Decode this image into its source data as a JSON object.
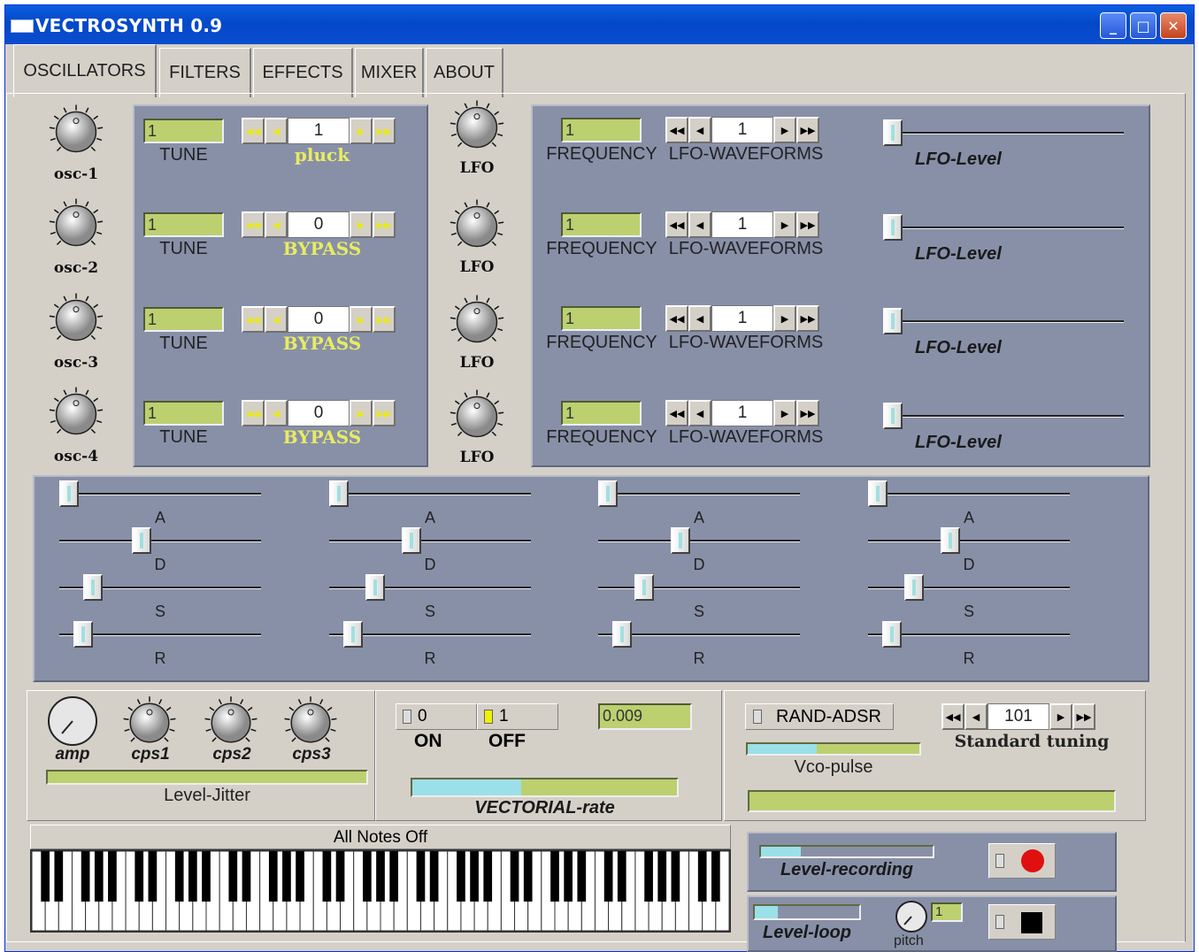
{
  "window": {
    "title": "VECTROSYNTH 0.9",
    "min_icon": "minimize-icon",
    "max_icon": "maximize-icon",
    "close_icon": "close-icon"
  },
  "tabs": [
    "OSCILLATORS",
    "FILTERS",
    "EFFECTS",
    "MIXER",
    "ABOUT"
  ],
  "active_tab": "OSCILLATORS",
  "oscillators": [
    {
      "knob": "osc-1",
      "tune_value": "1",
      "tune_label": "TUNE",
      "spin_value": "1",
      "spin_label": "pluck"
    },
    {
      "knob": "osc-2",
      "tune_value": "1",
      "tune_label": "TUNE",
      "spin_value": "0",
      "spin_label": "BYPASS"
    },
    {
      "knob": "osc-3",
      "tune_value": "1",
      "tune_label": "TUNE",
      "spin_value": "0",
      "spin_label": "BYPASS"
    },
    {
      "knob": "osc-4",
      "tune_value": "1",
      "tune_label": "TUNE",
      "spin_value": "0",
      "spin_label": "BYPASS"
    }
  ],
  "lfos": [
    {
      "knob": "LFO",
      "freq_value": "1",
      "freq_label": "FREQUENCY",
      "wave_value": "1",
      "wave_label": "LFO-WAVEFORMS",
      "level_label": "LFO-Level",
      "level": 0.0
    },
    {
      "knob": "LFO",
      "freq_value": "1",
      "freq_label": "FREQUENCY",
      "wave_value": "1",
      "wave_label": "LFO-WAVEFORMS",
      "level_label": "LFO-Level",
      "level": 0.0
    },
    {
      "knob": "LFO",
      "freq_value": "1",
      "freq_label": "FREQUENCY",
      "wave_value": "1",
      "wave_label": "LFO-WAVEFORMS",
      "level_label": "LFO-Level",
      "level": 0.0
    },
    {
      "knob": "LFO",
      "freq_value": "1",
      "freq_label": "FREQUENCY",
      "wave_value": "1",
      "wave_label": "LFO-WAVEFORMS",
      "level_label": "LFO-Level",
      "level": 0.0
    }
  ],
  "adsr_labels": [
    "A",
    "D",
    "S",
    "R"
  ],
  "adsr_groups": [
    {
      "A": 0.0,
      "D": 0.4,
      "S": 0.13,
      "R": 0.08
    },
    {
      "A": 0.0,
      "D": 0.4,
      "S": 0.2,
      "R": 0.08
    },
    {
      "A": 0.0,
      "D": 0.4,
      "S": 0.2,
      "R": 0.08
    },
    {
      "A": 0.0,
      "D": 0.4,
      "S": 0.2,
      "R": 0.08
    }
  ],
  "mixer": {
    "knobs": [
      "amp",
      "cps1",
      "cps2",
      "cps3"
    ],
    "jitter_label": "Level-Jitter"
  },
  "vector": {
    "on_value": "0",
    "on_label": "ON",
    "off_value": "1",
    "off_label": "OFF",
    "rate_value": "0.009",
    "rate_label": "VECTORIAL-rate",
    "rate_level": 0.41
  },
  "tuning": {
    "rand_label": "RAND-ADSR",
    "vco_label": "Vco-pulse",
    "vco_level": 0.4,
    "spin_value": "101",
    "spin_label": "Standard tuning"
  },
  "keyboard": {
    "all_notes_off": "All Notes Off"
  },
  "recording": {
    "label": "Level-recording",
    "level": 0.23
  },
  "loop": {
    "label": "Level-loop",
    "level": 0.22,
    "pitch_label": "pitch",
    "pitch_value": "1"
  },
  "colors": {
    "panel": "#8890a8",
    "field_green": "#bcd070",
    "yellow_label": "#e8ec60",
    "record": "#e01010"
  }
}
